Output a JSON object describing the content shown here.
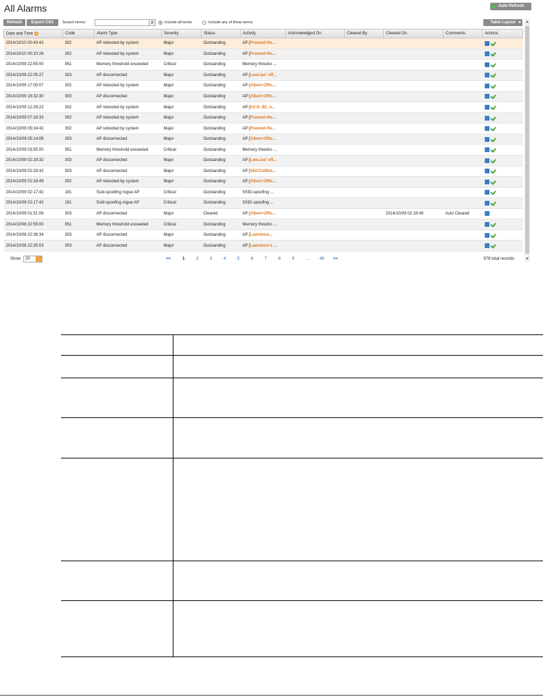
{
  "page": {
    "title": "All Alarms"
  },
  "toolbar": {
    "auto_refresh_label": "Auto Refresh",
    "refresh_label": "Refresh",
    "export_label": "Export CSV",
    "search_label": "Search terms:",
    "search_value": "",
    "search_clear": "X",
    "radio_all_label": "Include all terms",
    "radio_any_label": "Include any of these terms",
    "radio_selected": "all",
    "table_layout_label": "Table Layout"
  },
  "grid": {
    "columns": [
      "Date and Time",
      "Code",
      "Alarm Type",
      "Severity",
      "Status",
      "Activity",
      "Acknowledged On",
      "Cleared By",
      "Cleared On",
      "Comments",
      "Actions"
    ],
    "sort_icon": "sort-descending-icon",
    "rows": [
      {
        "datetime": "2014/10/10 00:43:42",
        "code": "302",
        "type": "AP rebooted by system",
        "severity": "Major",
        "status": "Outstanding",
        "act_prefix": "AP [",
        "act_name": "Pramod-Ho...",
        "ack_on": "",
        "cleared_by": "",
        "cleared_on": "",
        "comments": "",
        "acknowledge": true
      },
      {
        "datetime": "2014/10/10 00:10:26",
        "code": "302",
        "type": "AP rebooted by system",
        "severity": "Major",
        "status": "Outstanding",
        "act_prefix": "AP [",
        "act_name": "Pramod-Ho...",
        "ack_on": "",
        "cleared_by": "",
        "cleared_on": "",
        "comments": "",
        "acknowledge": true
      },
      {
        "datetime": "2014/10/09 22:55:00",
        "code": "951",
        "type": "Memory threshold exceeded",
        "severity": "Critical",
        "status": "Outstanding",
        "act_prefix": "Memory thresho ...",
        "act_name": "",
        "ack_on": "",
        "cleared_by": "",
        "cleared_on": "",
        "comments": "",
        "acknowledge": true
      },
      {
        "datetime": "2014/10/09 22:05:27",
        "code": "303",
        "type": "AP disconnected",
        "severity": "Major",
        "status": "Outstanding",
        "act_prefix": "AP [",
        "act_name": "LeoLiao' off...",
        "ack_on": "",
        "cleared_by": "",
        "cleared_on": "",
        "comments": "",
        "acknowledge": true
      },
      {
        "datetime": "2014/10/09 17:00:07",
        "code": "302",
        "type": "AP rebooted by system",
        "severity": "Major",
        "status": "Outstanding",
        "act_prefix": "AP [",
        "act_name": "Albert-Offic...",
        "ack_on": "",
        "cleared_by": "",
        "cleared_on": "",
        "comments": "",
        "acknowledge": true
      },
      {
        "datetime": "2014/10/09 16:32:30",
        "code": "303",
        "type": "AP disconnected",
        "severity": "Major",
        "status": "Outstanding",
        "act_prefix": "AP [",
        "act_name": "Albert-Offic...",
        "ack_on": "",
        "cleared_by": "",
        "cleared_on": "",
        "comments": "",
        "acknowledge": true
      },
      {
        "datetime": "2014/10/09 12:29:22",
        "code": "302",
        "type": "AP rebooted by system",
        "severity": "Major",
        "status": "Outstanding",
        "act_prefix": "AP [",
        "act_name": "Inf-O_B1_e...",
        "ack_on": "",
        "cleared_by": "",
        "cleared_on": "",
        "comments": "",
        "acknowledge": true
      },
      {
        "datetime": "2014/10/09 07:16:33",
        "code": "302",
        "type": "AP rebooted by system",
        "severity": "Major",
        "status": "Outstanding",
        "act_prefix": "AP [",
        "act_name": "Pramod-Ho...",
        "ack_on": "",
        "cleared_by": "",
        "cleared_on": "",
        "comments": "",
        "acknowledge": true
      },
      {
        "datetime": "2014/10/09 05:34:42",
        "code": "302",
        "type": "AP rebooted by system",
        "severity": "Major",
        "status": "Outstanding",
        "act_prefix": "AP [",
        "act_name": "Pramod-Ho...",
        "ack_on": "",
        "cleared_by": "",
        "cleared_on": "",
        "comments": "",
        "acknowledge": true
      },
      {
        "datetime": "2014/10/09 05:14:08",
        "code": "303",
        "type": "AP disconnected",
        "severity": "Major",
        "status": "Outstanding",
        "act_prefix": "AP [",
        "act_name": "Albert-Offic...",
        "ack_on": "",
        "cleared_by": "",
        "cleared_on": "",
        "comments": "",
        "acknowledge": true
      },
      {
        "datetime": "2014/10/09 03:55:00",
        "code": "951",
        "type": "Memory threshold exceeded",
        "severity": "Critical",
        "status": "Outstanding",
        "act_prefix": "Memory thresho ...",
        "act_name": "",
        "ack_on": "",
        "cleared_by": "",
        "cleared_on": "",
        "comments": "",
        "acknowledge": true
      },
      {
        "datetime": "2014/10/09 02:29:32",
        "code": "303",
        "type": "AP disconnected",
        "severity": "Major",
        "status": "Outstanding",
        "act_prefix": "AP [",
        "act_name": "LeoLiao' off...",
        "ack_on": "",
        "cleared_by": "",
        "cleared_on": "",
        "comments": "",
        "acknowledge": true
      },
      {
        "datetime": "2014/10/09 02:28:42",
        "code": "303",
        "type": "AP disconnected",
        "severity": "Major",
        "status": "Outstanding",
        "act_prefix": "AP [",
        "act_name": "SDCCotDot...",
        "ack_on": "",
        "cleared_by": "",
        "cleared_on": "",
        "comments": "",
        "acknowledge": true
      },
      {
        "datetime": "2014/10/09 02:18:49",
        "code": "302",
        "type": "AP rebooted by system",
        "severity": "Major",
        "status": "Outstanding",
        "act_prefix": "AP [",
        "act_name": "Albert-Offic...",
        "ack_on": "",
        "cleared_by": "",
        "cleared_on": "",
        "comments": "",
        "acknowledge": true
      },
      {
        "datetime": "2014/10/09 02:17:42",
        "code": "181",
        "type": "Ssid-spoofing rogue AP",
        "severity": "Critical",
        "status": "Outstanding",
        "act_prefix": "SSID-spoofing ...",
        "act_name": "",
        "ack_on": "",
        "cleared_by": "",
        "cleared_on": "",
        "comments": "",
        "acknowledge": true
      },
      {
        "datetime": "2014/10/09 02:17:42",
        "code": "181",
        "type": "Ssid-spoofing rogue AP",
        "severity": "Critical",
        "status": "Outstanding",
        "act_prefix": "SSID-spoofing ...",
        "act_name": "",
        "ack_on": "",
        "cleared_by": "",
        "cleared_on": "",
        "comments": "",
        "acknowledge": true
      },
      {
        "datetime": "2014/10/09 01:51:06",
        "code": "303",
        "type": "AP disconnected",
        "severity": "Major",
        "status": "Cleared",
        "act_prefix": "AP [",
        "act_name": "Albert-Offic...",
        "ack_on": "",
        "cleared_by": "",
        "cleared_on": "2014/10/09 02:18:49",
        "comments": "Auto Cleared",
        "acknowledge": false
      },
      {
        "datetime": "2014/10/08 22:55:00",
        "code": "951",
        "type": "Memory threshold exceeded",
        "severity": "Critical",
        "status": "Outstanding",
        "act_prefix": "Memory thresho ...",
        "act_name": "",
        "ack_on": "",
        "cleared_by": "",
        "cleared_on": "",
        "comments": "",
        "acknowledge": true
      },
      {
        "datetime": "2014/10/08 22:36:34",
        "code": "303",
        "type": "AP disconnected",
        "severity": "Major",
        "status": "Outstanding",
        "act_prefix": "AP [",
        "act_name": "Lawrence...",
        "ack_on": "",
        "cleared_by": "",
        "cleared_on": "",
        "comments": "",
        "acknowledge": true
      },
      {
        "datetime": "2014/10/08 22:35:03",
        "code": "303",
        "type": "AP disconnected",
        "severity": "Major",
        "status": "Outstanding",
        "act_prefix": "AP [",
        "act_name": "Lawrence's ...",
        "ack_on": "",
        "cleared_by": "",
        "cleared_on": "",
        "comments": "",
        "acknowledge": true
      }
    ],
    "action_icons": {
      "edit": "note-edit-icon",
      "acknowledge": "checkmark-icon"
    }
  },
  "footer": {
    "show_label": "Show",
    "show_value": "20",
    "pager_first": "<<",
    "pager_pages": [
      "1",
      "2",
      "3",
      "4",
      "5",
      "6",
      "7",
      "8",
      "9",
      "...",
      "49"
    ],
    "pager_current": "1",
    "pager_next": ">>",
    "total_records": "978 total records"
  },
  "colors": {
    "accent_orange": "#e0781c",
    "button_gray": "#8a8a8a",
    "selected_row": "#fdeedc",
    "link_blue": "#225ea8"
  }
}
